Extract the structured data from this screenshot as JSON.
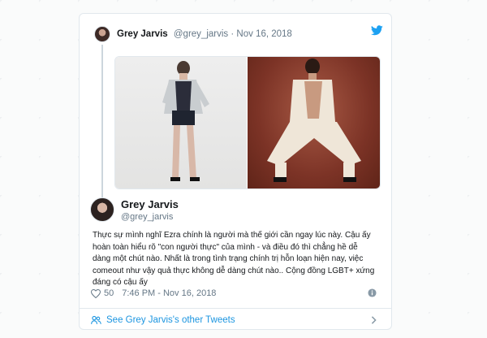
{
  "parent_tweet": {
    "author_name": "Grey Jarvis",
    "handle": "@grey_jarvis",
    "separator": "·",
    "date": "Nov 16, 2018"
  },
  "reply_tweet": {
    "author_name": "Grey Jarvis",
    "handle": "@grey_jarvis",
    "text": "Thực sự mình nghĩ Ezra chính là người mà thế giới cần ngay lúc này. Cậu ấy hoàn toàn hiểu rõ \"con người thực\" của mình - và điều đó thì chẳng hề dễ dàng một chút nào. Nhất là trong tình trạng chính trị hỗn loạn hiện nay, việc comeout như vậy quả thực không dễ dàng chút nào.. Cộng đồng LGBT+ xứng đáng có cậu ấy",
    "likes": "50",
    "timestamp": "7:46 PM - Nov 16, 2018"
  },
  "footer": {
    "link_label": "See Grey Jarvis's other Tweets"
  },
  "colors": {
    "twitter_blue": "#1da1f2",
    "link_blue": "#1b95e0",
    "muted": "#657786",
    "text": "#14171a",
    "border": "#e1e8ed"
  },
  "icons": [
    "twitter-bird-icon",
    "heart-icon",
    "info-icon",
    "people-icon",
    "chevron-right-icon"
  ]
}
